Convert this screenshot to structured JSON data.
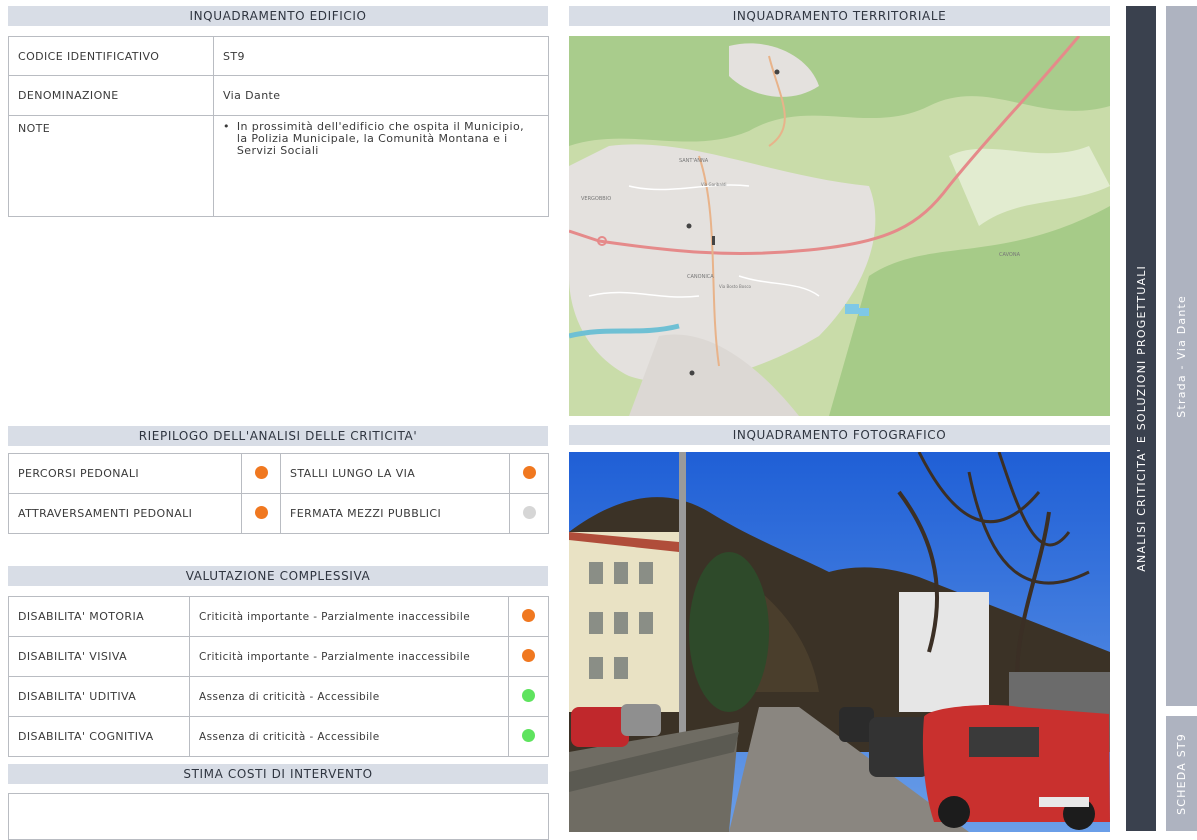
{
  "building": {
    "header": "INQUADRAMENTO EDIFICIO",
    "rows": [
      {
        "label": "CODICE IDENTIFICATIVO",
        "value": "ST9"
      },
      {
        "label": "DENOMINAZIONE",
        "value": "Via Dante"
      },
      {
        "label": "NOTE",
        "value": "In prossimità dell'edificio che ospita il Municipio, la Polizia Municipale, la Comunità Montana e i Servizi Sociali"
      }
    ]
  },
  "territory": {
    "header": "INQUADRAMENTO TERRITORIALE",
    "map_labels": [
      "VERGOBBIO",
      "SANT'ANNA",
      "CANONICA",
      "CAVONA",
      "Via Garibaldi",
      "Via Bosto Bosco"
    ]
  },
  "photo": {
    "header": "INQUADRAMENTO FOTOGRAFICO"
  },
  "summary": {
    "header": "RIEPILOGO DELL'ANALISI DELLE CRITICITA'",
    "items": [
      {
        "label": "PERCORSI PEDONALI",
        "color": "#f07820"
      },
      {
        "label": "STALLI LUNGO LA VIA",
        "color": "#f07820"
      },
      {
        "label": "ATTRAVERSAMENTI PEDONALI",
        "color": "#f07820"
      },
      {
        "label": "FERMATA MEZZI PUBBLICI",
        "color": "#d6d6d6"
      }
    ]
  },
  "evaluation": {
    "header": "VALUTAZIONE COMPLESSIVA",
    "rows": [
      {
        "label": "DISABILITA' MOTORIA",
        "value": "Criticità importante - Parzialmente inaccessibile",
        "color": "#f07820"
      },
      {
        "label": "DISABILITA' VISIVA",
        "value": "Criticità importante - Parzialmente inaccessibile",
        "color": "#f07820"
      },
      {
        "label": "DISABILITA' UDITIVA",
        "value": "Assenza di criticità - Accessibile",
        "color": "#5ee35e"
      },
      {
        "label": "DISABILITA' COGNITIVA",
        "value": "Assenza di criticità - Accessibile",
        "color": "#5ee35e"
      }
    ]
  },
  "costs": {
    "header": "STIMA COSTI DI INTERVENTO"
  },
  "side": {
    "main": "ANALISI CRITICITA' E SOLUZIONI PROGETTUALI",
    "sub": "Strada - Via Dante",
    "card": "SCHEDA ST9"
  }
}
